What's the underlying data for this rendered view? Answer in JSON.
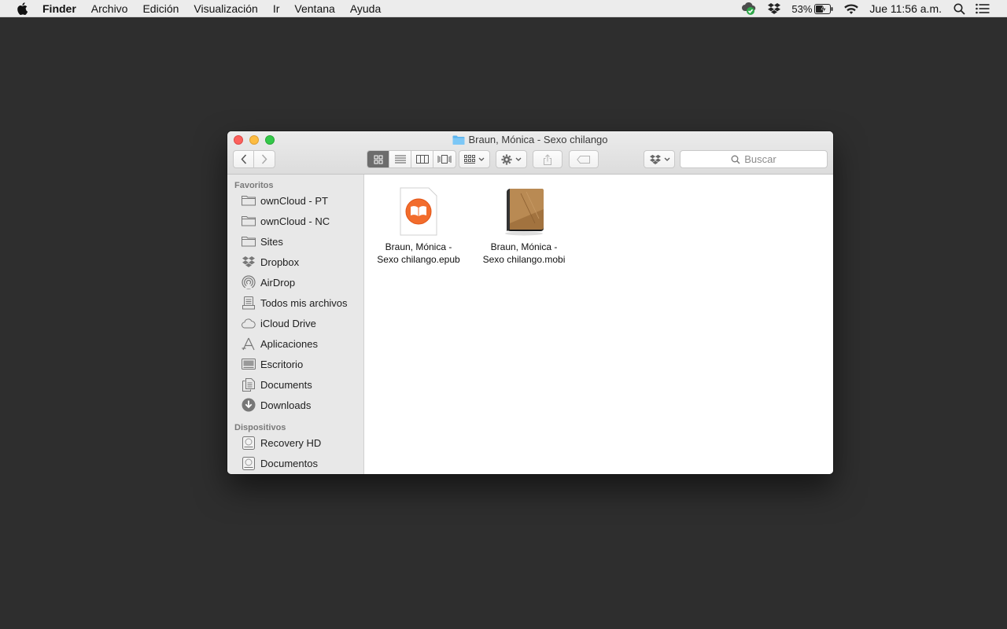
{
  "menubar": {
    "app": "Finder",
    "items": [
      "Archivo",
      "Edición",
      "Visualización",
      "Ir",
      "Ventana",
      "Ayuda"
    ],
    "battery": "53%",
    "clock": "Jue 11:56 a.m."
  },
  "window": {
    "title": "Braun, Mónica - Sexo chilango",
    "search_placeholder": "Buscar"
  },
  "sidebar": {
    "favorites_header": "Favoritos",
    "favorites": [
      {
        "label": "ownCloud - PT",
        "icon": "folder-icon"
      },
      {
        "label": "ownCloud - NC",
        "icon": "folder-icon"
      },
      {
        "label": "Sites",
        "icon": "folder-icon"
      },
      {
        "label": "Dropbox",
        "icon": "dropbox-icon"
      },
      {
        "label": "AirDrop",
        "icon": "airdrop-icon"
      },
      {
        "label": "Todos mis archivos",
        "icon": "all-files-icon"
      },
      {
        "label": "iCloud Drive",
        "icon": "cloud-icon"
      },
      {
        "label": "Aplicaciones",
        "icon": "applications-icon"
      },
      {
        "label": "Escritorio",
        "icon": "desktop-icon"
      },
      {
        "label": "Documents",
        "icon": "documents-icon"
      },
      {
        "label": "Downloads",
        "icon": "downloads-icon"
      }
    ],
    "devices_header": "Dispositivos",
    "devices": [
      {
        "label": "Recovery HD",
        "icon": "disk-icon"
      },
      {
        "label": "Documentos",
        "icon": "disk-icon"
      }
    ]
  },
  "files": [
    {
      "line1": "Braun, Mónica -",
      "line2": "Sexo chilango.epub",
      "icon": "ibooks-epub-icon"
    },
    {
      "line1": "Braun, Mónica -",
      "line2": "Sexo chilango.mobi",
      "icon": "book-mobi-icon"
    }
  ]
}
